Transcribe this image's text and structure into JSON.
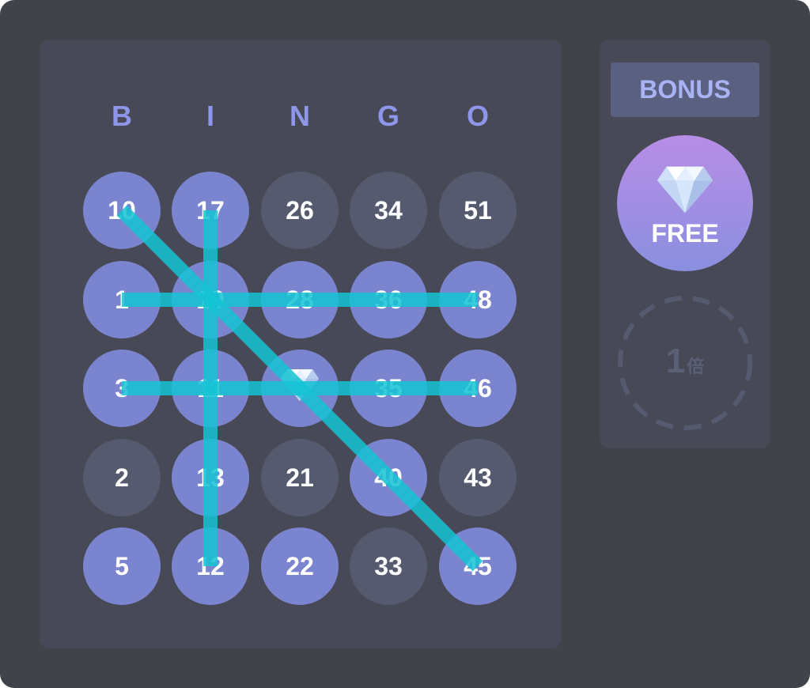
{
  "board": {
    "headers": [
      "B",
      "I",
      "N",
      "G",
      "O"
    ],
    "rows": [
      [
        {
          "value": "10",
          "marked": true
        },
        {
          "value": "17",
          "marked": true
        },
        {
          "value": "26",
          "marked": false
        },
        {
          "value": "34",
          "marked": false
        },
        {
          "value": "51",
          "marked": false
        }
      ],
      [
        {
          "value": "1",
          "marked": true
        },
        {
          "value": "19",
          "marked": true
        },
        {
          "value": "28",
          "marked": true
        },
        {
          "value": "36",
          "marked": true
        },
        {
          "value": "48",
          "marked": true
        }
      ],
      [
        {
          "value": "3",
          "marked": true
        },
        {
          "value": "11",
          "marked": true
        },
        {
          "value": "",
          "marked": true,
          "icon": "diamond-icon",
          "free": true
        },
        {
          "value": "35",
          "marked": true
        },
        {
          "value": "46",
          "marked": true
        }
      ],
      [
        {
          "value": "2",
          "marked": false
        },
        {
          "value": "13",
          "marked": true
        },
        {
          "value": "21",
          "marked": false
        },
        {
          "value": "40",
          "marked": true
        },
        {
          "value": "43",
          "marked": false
        }
      ],
      [
        {
          "value": "5",
          "marked": true
        },
        {
          "value": "12",
          "marked": true
        },
        {
          "value": "22",
          "marked": true
        },
        {
          "value": "33",
          "marked": false
        },
        {
          "value": "45",
          "marked": true
        }
      ]
    ],
    "winning_lines": [
      {
        "name": "row-2",
        "from": [
          1,
          0
        ],
        "to": [
          1,
          4
        ]
      },
      {
        "name": "row-3",
        "from": [
          2,
          0
        ],
        "to": [
          2,
          4
        ]
      },
      {
        "name": "column-i",
        "from": [
          0,
          1
        ],
        "to": [
          4,
          1
        ]
      },
      {
        "name": "diagonal",
        "from": [
          0,
          0
        ],
        "to": [
          4,
          4
        ]
      }
    ]
  },
  "side": {
    "bonus_label": "BONUS",
    "free_label": "FREE",
    "free_icon": "diamond-icon",
    "multiplier_value": "1",
    "multiplier_unit": "倍"
  },
  "colors": {
    "background": "#41434b",
    "panel": "#474956",
    "marked_cell": "#7b85cf",
    "unmarked_cell": "#555a6f",
    "header_letter": "#8d96e8",
    "line": "#14c3d3",
    "bonus_bg": "#5a6080",
    "bonus_text": "#a9b3f3",
    "free_gradient_top": "#b88de6",
    "free_gradient_bottom": "#8a8fe0",
    "multiplier": "#5a6076"
  }
}
